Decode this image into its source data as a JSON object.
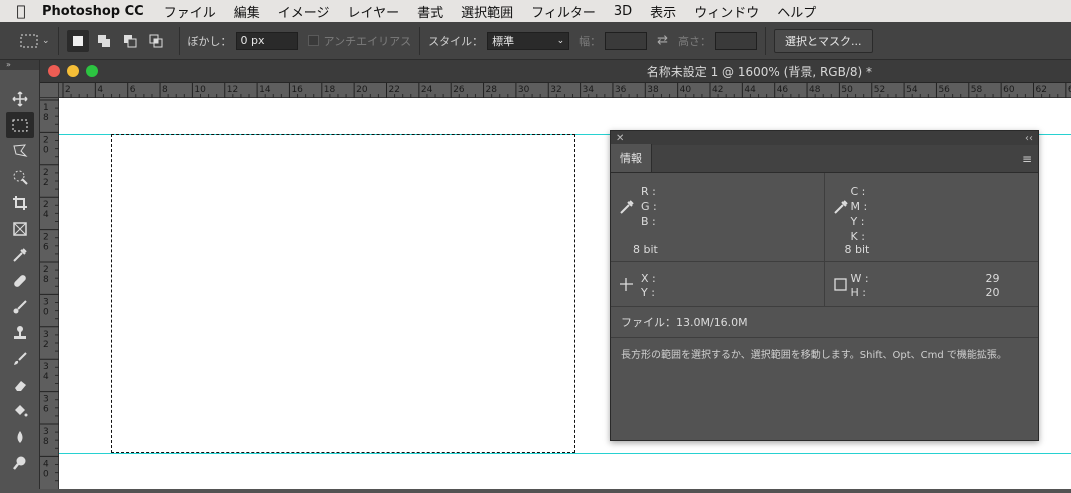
{
  "menubar": {
    "app_name": "Photoshop CC",
    "items": [
      "ファイル",
      "編集",
      "イメージ",
      "レイヤー",
      "書式",
      "選択範囲",
      "フィルター",
      "3D",
      "表示",
      "ウィンドウ",
      "ヘルプ"
    ]
  },
  "options": {
    "feather_label": "ぼかし：",
    "feather_value": "0 px",
    "antialias_label": "アンチエイリアス",
    "style_label": "スタイル：",
    "style_value": "標準",
    "width_label": "幅：",
    "height_label": "高さ：",
    "select_mask_label": "選択とマスク..."
  },
  "document": {
    "title": "名称未設定 1 @ 1600% (背景, RGB/8) *",
    "hruler_ticks": [
      "2",
      "4",
      "6",
      "8",
      "10",
      "12",
      "14",
      "16",
      "18",
      "20",
      "22",
      "24",
      "26",
      "28",
      "30",
      "32",
      "34",
      "36",
      "38",
      "40",
      "42",
      "44",
      "46",
      "48",
      "50",
      "52",
      "54",
      "56",
      "58",
      "60",
      "62",
      "64"
    ],
    "vruler_ticks": [
      "1\n8",
      "2\n0",
      "2\n2",
      "2\n4",
      "2\n6",
      "2\n8",
      "3\n0",
      "3\n2",
      "3\n4",
      "3\n6",
      "3\n8",
      "4\n0"
    ]
  },
  "info_panel": {
    "tab_label": "情報",
    "rgb": {
      "r": "R :",
      "g": "G :",
      "b": "B :",
      "bit": "8 bit"
    },
    "cmyk": {
      "c": "C :",
      "m": "M :",
      "y": "Y :",
      "k": "K :",
      "bit": "8 bit"
    },
    "xy": {
      "x": "X :",
      "y": "Y :"
    },
    "wh": {
      "w": "W :",
      "h": "H :",
      "w_value": "29",
      "h_value": "20"
    },
    "file_info": "ファイル：13.0M/16.0M",
    "hint": "長方形の範囲を選択するか、選択範囲を移動します。Shift、Opt、Cmd で機能拡張。"
  },
  "colors": {
    "guide": "#27d1d1",
    "close": "#ee5d54",
    "minimize": "#f5be37",
    "zoom": "#2cc441"
  }
}
